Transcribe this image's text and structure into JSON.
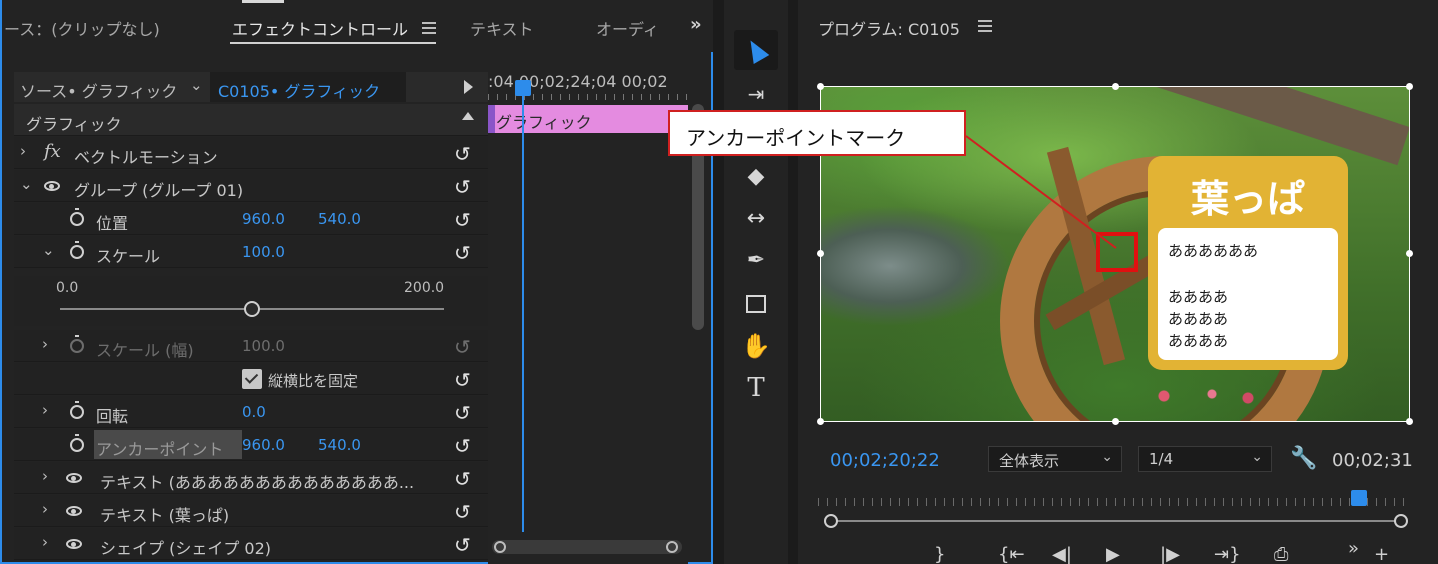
{
  "left_panel": {
    "tabs": [
      {
        "label": "ース：(クリップなし)"
      },
      {
        "label": "エフェクトコントロール"
      },
      {
        "label": "テキスト"
      },
      {
        "label": "オーディ"
      }
    ],
    "overflow": "»",
    "source_label": "ソース• グラフィック",
    "clip_label": "C0105• グラフィック",
    "header": "グラフィック",
    "rows": {
      "vector_motion": "ベクトルモーション",
      "group": "グループ (グループ 01)",
      "position": {
        "label": "位置",
        "x": "960.0",
        "y": "540.0"
      },
      "scale": {
        "label": "スケール",
        "value": "100.0"
      },
      "scale_width": {
        "label": "スケール (幅)",
        "value": "100.0"
      },
      "aspect_lock": "縦横比を固定",
      "rotation": {
        "label": "回転",
        "value": "0.0"
      },
      "anchor": {
        "label": "アンカーポイント",
        "x": "960.0",
        "y": "540.0"
      },
      "text1": "テキスト (ああああああああああああああ...",
      "text2": "テキスト (葉っぱ)",
      "shape": "シェイプ (シェイプ 02)"
    },
    "slider": {
      "min": "0.0",
      "max": "200.0",
      "value": 100,
      "range_max": 200
    }
  },
  "mini_timeline": {
    "time": ":04 00;02;24;04  00;02",
    "clip_label": "グラフィック"
  },
  "program": {
    "title": "プログラム: C0105",
    "card": {
      "title": "葉っぱ",
      "lines": [
        "ああああああ",
        "",
        "ああああ",
        "ああああ",
        "ああああ"
      ]
    },
    "timecode": "00;02;20;22",
    "zoom_select": "全体表示",
    "resolution_select": "1/4",
    "end_timecode": "00;02;31"
  },
  "callout": {
    "label": "アンカーポイントマーク"
  },
  "icons": {
    "reset": "↺",
    "wrench": "🔧"
  },
  "colors": {
    "accent_blue": "#2d8ceb",
    "clip_pink": "#e48be0",
    "card_yellow": "#e2b334",
    "callout_red": "#d02020"
  }
}
